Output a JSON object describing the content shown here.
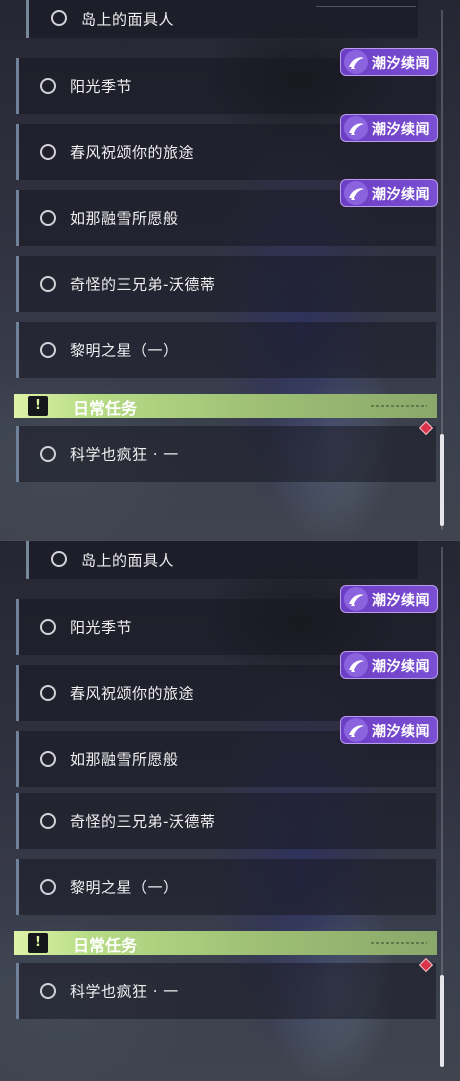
{
  "quests": [
    {
      "label": "岛上的面具人"
    },
    {
      "label": "阳光季节"
    },
    {
      "label": "春风祝颂你的旅途"
    },
    {
      "label": "如那融雪所愿般"
    },
    {
      "label": "奇怪的三兄弟-沃德蒂"
    },
    {
      "label": "黎明之星（一）"
    }
  ],
  "badge": {
    "label": "潮汐续闻",
    "icon": "tide-icon"
  },
  "daily": {
    "title": "日常任务",
    "icon": "exclamation-icon",
    "quest": {
      "label": "科学也疯狂 · 一"
    }
  },
  "colors": {
    "badge_purple": "#7a4fd2",
    "section_green": "#b7dc86",
    "marker_red": "#d8344a"
  }
}
